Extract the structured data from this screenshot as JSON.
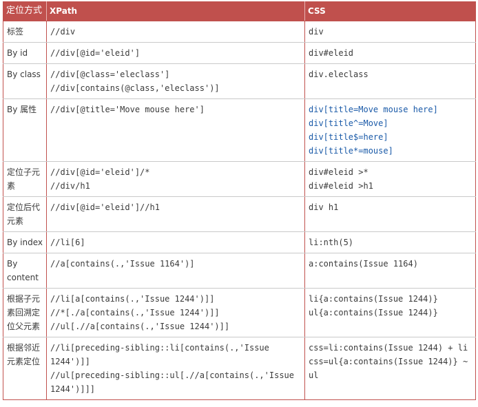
{
  "table": {
    "headers": [
      "定位方式",
      "XPath",
      "CSS"
    ],
    "rows": [
      {
        "method": "标签",
        "xpath": [
          "//div"
        ],
        "css": [
          "div"
        ]
      },
      {
        "method": "By id",
        "xpath": [
          "//div[@id='eleid']"
        ],
        "css": [
          "div#eleid"
        ]
      },
      {
        "method": "By class",
        "xpath": [
          "//div[@class='eleclass']",
          "//div[contains(@class,'eleclass')]"
        ],
        "css": [
          "div.eleclass"
        ]
      },
      {
        "method": "By 属性",
        "xpath": [
          "//div[@title='Move mouse here']"
        ],
        "css": [
          "div[title=Move mouse here]",
          "div[title^=Move]",
          "div[title$=here]",
          "div[title*=mouse]"
        ]
      },
      {
        "method": "定位子元素",
        "xpath": [
          "//div[@id='eleid']/*",
          "//div/h1"
        ],
        "css": [
          "div#eleid >*",
          "div#eleid >h1"
        ]
      },
      {
        "method": "定位后代元素",
        "xpath": [
          "//div[@id='eleid']//h1"
        ],
        "css": [
          "div h1"
        ]
      },
      {
        "method": "By index",
        "xpath": [
          "//li[6]"
        ],
        "css": [
          "li:nth(5)"
        ]
      },
      {
        "method": "By content",
        "xpath": [
          "//a[contains(.,'Issue 1164')]"
        ],
        "css": [
          "a:contains(Issue 1164)"
        ]
      },
      {
        "method": "根据子元素回溯定位父元素",
        "xpath": [
          "//li[a[contains(.,'Issue 1244')]]",
          "//*[./a[contains(.,'Issue 1244')]]",
          "//ul[.//a[contains(.,'Issue 1244')]]"
        ],
        "css": [
          "li{a:contains(Issue 1244)}",
          "ul{a:contains(Issue 1244)}"
        ]
      },
      {
        "method": "根据邻近元素定位",
        "xpath": [
          "//li[preceding-sibling::li[contains(.,'Issue 1244')]]",
          "//ul[preceding-sibling::ul[.//a[contains(.,'Issue 1244')]]]"
        ],
        "css": [
          "css=li:contains(Issue 1244) + li",
          "css=ul{a:contains(Issue 1244)} ~ ul"
        ]
      }
    ]
  },
  "colors": {
    "header_bg": "#c0504d",
    "header_text": "#ffffff",
    "css_attr_text": "#1a5aa8"
  }
}
